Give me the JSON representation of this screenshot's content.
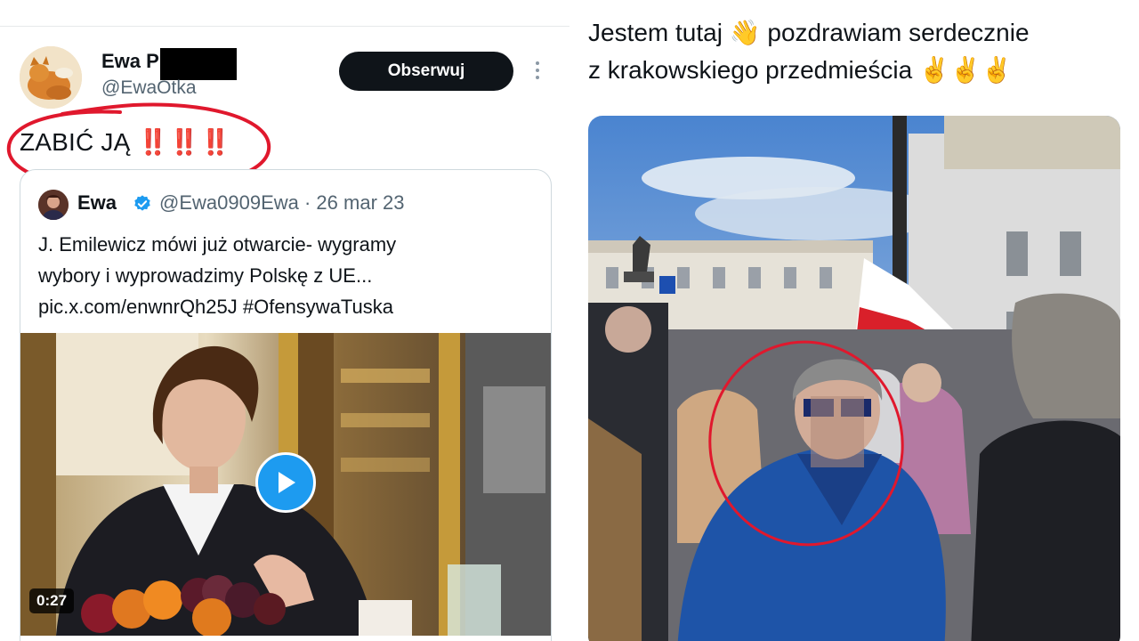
{
  "left_tweet": {
    "author_name": "Ewa P",
    "author_handle": "@EwaOtka",
    "follow_label": "Obserwuj",
    "text": "ZABIĆ JĄ ‼️‼️‼️",
    "quoted": {
      "author_name": "Ewa",
      "author_handle": "@Ewa0909Ewa · 26 mar 23",
      "line1": "J. Emilewicz mówi już otwarcie- wygramy",
      "line2": "wybory i wyprowadzimy Polskę z UE...",
      "line3": "pic.x.com/enwnrQh25J #OfensywaTuska",
      "video_duration": "0:27"
    }
  },
  "right_tweet": {
    "line1": "Jestem tutaj 👋 pozdrawiam serdecznie",
    "line2": "z krakowskiego przedmieścia ✌️✌️✌️"
  },
  "colors": {
    "follow_button_bg": "#0f1419",
    "verified_blue": "#1d9bf0",
    "annotation_red": "#e0182d",
    "handle_gray": "#536471"
  },
  "icons": [
    "more-icon",
    "verified-icon",
    "play-icon"
  ]
}
